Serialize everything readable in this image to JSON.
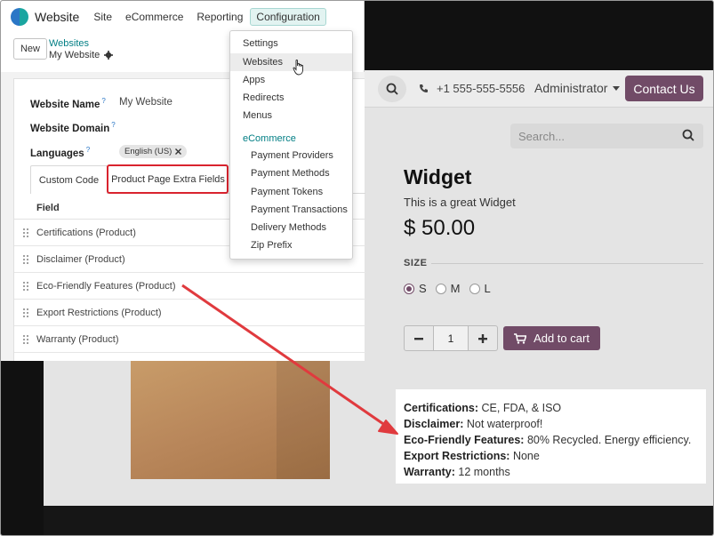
{
  "website": {
    "nav": {
      "phone": "+1 555-555-5556",
      "user": "Administrator",
      "contact_button": "Contact Us"
    },
    "search_placeholder": "Search...",
    "product": {
      "title": "Widget",
      "description": "This is a great Widget",
      "price": "$ 50.00",
      "size_label": "SIZE",
      "sizes": [
        "S",
        "M",
        "L"
      ],
      "selected_size": "S",
      "quantity": "1",
      "add_to_cart": "Add to cart"
    },
    "extra_fields": [
      {
        "label": "Certifications:",
        "value": "CE, FDA, & ISO"
      },
      {
        "label": "Disclaimer:",
        "value": "Not waterproof!"
      },
      {
        "label": "Eco-Friendly Features:",
        "value": "80% Recycled. Energy efficiency."
      },
      {
        "label": "Export Restrictions:",
        "value": "None"
      },
      {
        "label": "Warranty:",
        "value": "12 months"
      }
    ]
  },
  "backend": {
    "app_name": "Website",
    "menu": [
      "Site",
      "eCommerce",
      "Reporting",
      "Configuration"
    ],
    "new_button": "New",
    "breadcrumb_parent": "Websites",
    "breadcrumb_current": "My Website",
    "form": {
      "website_name_label": "Website Name",
      "website_name_value": "My Website",
      "website_domain_label": "Website Domain",
      "languages_label": "Languages",
      "language_tag": "English (US)",
      "help_mark": "?"
    },
    "tabs": [
      "Custom Code",
      "Product Page Extra Fields"
    ],
    "table_header": "Field",
    "rows": [
      "Certifications (Product)",
      "Disclaimer (Product)",
      "Eco-Friendly Features (Product)",
      "Export Restrictions (Product)",
      "Warranty (Product)"
    ],
    "dropdown": {
      "items": [
        "Settings",
        "Websites",
        "Apps",
        "Redirects",
        "Menus"
      ],
      "section": "eCommerce",
      "sub_items": [
        "Payment Providers",
        "Payment Methods",
        "Payment Tokens",
        "Payment Transactions",
        "Delivery Methods",
        "Zip Prefix"
      ]
    }
  },
  "colors": {
    "brand": "#714b67",
    "teal": "#017e84",
    "highlight_red": "#d9232e"
  }
}
